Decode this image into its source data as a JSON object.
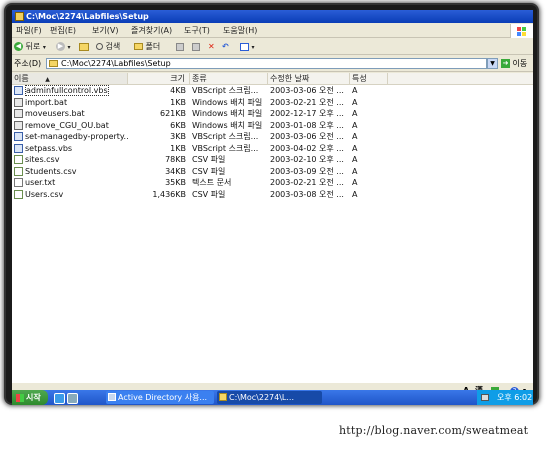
{
  "window": {
    "title": "C:\\Moc\\2274\\Labfiles\\Setup"
  },
  "menu": [
    "파일(F)",
    "편집(E)",
    "보기(V)",
    "즐겨찾기(A)",
    "도구(T)",
    "도움말(H)"
  ],
  "toolbar": {
    "back": "뒤로",
    "search": "검색",
    "folders": "폴더"
  },
  "address": {
    "label": "주소(D)",
    "value": "C:\\Moc\\2274\\Labfiles\\Setup",
    "go": "이동"
  },
  "columns": {
    "name": "이름",
    "size": "크기",
    "type": "종류",
    "modified": "수정한 날짜",
    "attributes": "특성"
  },
  "files": [
    {
      "name": "adminfullcontrol.vbs",
      "size": "4KB",
      "type": "VBScript 스크립...",
      "modified": "2003-03-06 오전 ...",
      "attr": "A",
      "icon": "vbs-file-icon"
    },
    {
      "name": "import.bat",
      "size": "1KB",
      "type": "Windows 배치 파일",
      "modified": "2003-02-21 오전 ...",
      "attr": "A",
      "icon": "batch-file-icon"
    },
    {
      "name": "moveusers.bat",
      "size": "621KB",
      "type": "Windows 배치 파일",
      "modified": "2002-12-17 오후 ...",
      "attr": "A",
      "icon": "batch-file-icon"
    },
    {
      "name": "remove_CGU_OU.bat",
      "size": "6KB",
      "type": "Windows 배치 파일",
      "modified": "2003-01-08 오후 ...",
      "attr": "A",
      "icon": "batch-file-icon"
    },
    {
      "name": "set-managedby-property...",
      "size": "3KB",
      "type": "VBScript 스크립...",
      "modified": "2003-03-06 오전 ...",
      "attr": "A",
      "icon": "vbs-file-icon"
    },
    {
      "name": "setpass.vbs",
      "size": "1KB",
      "type": "VBScript 스크립...",
      "modified": "2003-04-02 오후 ...",
      "attr": "A",
      "icon": "vbs-file-icon"
    },
    {
      "name": "sites.csv",
      "size": "78KB",
      "type": "CSV 파일",
      "modified": "2003-02-10 오후 ...",
      "attr": "A",
      "icon": "csv-file-icon"
    },
    {
      "name": "Students.csv",
      "size": "34KB",
      "type": "CSV 파일",
      "modified": "2003-03-09 오전 ...",
      "attr": "A",
      "icon": "csv-file-icon"
    },
    {
      "name": "user.txt",
      "size": "35KB",
      "type": "텍스트 문서",
      "modified": "2003-02-21 오전 ...",
      "attr": "A",
      "icon": "text-file-icon"
    },
    {
      "name": "Users.csv",
      "size": "1,436KB",
      "type": "CSV 파일",
      "modified": "2003-03-08 오전 ...",
      "attr": "A",
      "icon": "csv-file-icon"
    }
  ],
  "ime": {
    "a": "A",
    "hanja": "漢",
    "help": "?"
  },
  "taskbar": {
    "start": "시작",
    "tasks": [
      "Active Directory 사용...",
      "C:\\Moc\\2274\\L..."
    ],
    "clock": "오후 6:02"
  },
  "watermark": "http://blog.naver.com/sweatmeat",
  "colors": {
    "titlebar": "#0a3db6",
    "taskbar": "#1f55c9",
    "start": "#2d8a2d",
    "tray": "#0f9de7"
  }
}
